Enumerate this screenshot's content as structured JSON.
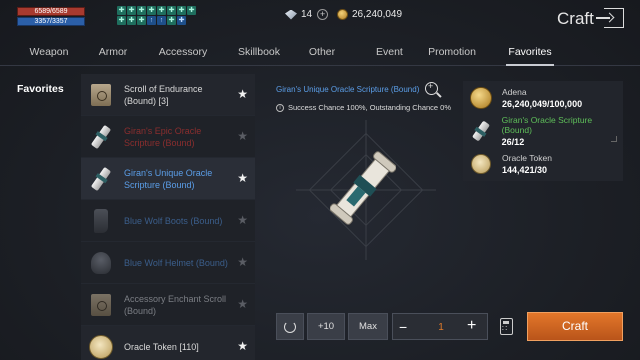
{
  "status": {
    "hp": "6589/6589",
    "mp": "3357/3357",
    "buffs": [
      "✚",
      "✚",
      "✚",
      "✚",
      "✚",
      "✚",
      "✚",
      "✚",
      "✚",
      "✚",
      "✚",
      "↑",
      "↑",
      "✚",
      "✚"
    ],
    "gems": "14",
    "adena": "26,240,049"
  },
  "header": {
    "title": "Craft"
  },
  "tabs": [
    "Weapon",
    "Armor",
    "Accessory",
    "Skillbook",
    "Other",
    "Event",
    "Promotion",
    "Favorites"
  ],
  "sidenav": {
    "label": "Favorites"
  },
  "items": [
    {
      "name": "Scroll of Endurance (Bound) [3]",
      "color": "white",
      "thumb": "scroll",
      "starred": true
    },
    {
      "name": "Giran's Epic Oracle Scripture (Bound)",
      "color": "red",
      "thumb": "oracle",
      "starred": true
    },
    {
      "name": "Giran's Unique Oracle Scripture (Bound)",
      "color": "blue",
      "thumb": "oracle",
      "starred": true
    },
    {
      "name": "Blue Wolf Boots (Bound)",
      "color": "blue-dim",
      "thumb": "boots",
      "starred": true
    },
    {
      "name": "Blue Wolf Helmet (Bound)",
      "color": "blue-dim",
      "thumb": "helmet",
      "starred": true
    },
    {
      "name": "Accessory Enchant Scroll (Bound)",
      "color": "gray",
      "thumb": "scroll",
      "starred": true
    },
    {
      "name": "Oracle Token [110]",
      "color": "white",
      "thumb": "token",
      "starred": true
    }
  ],
  "detail": {
    "title": "Giran's Unique Oracle Scripture (Bound)",
    "info": "Success Chance 100%, Outstanding Chance 0%"
  },
  "materials": [
    {
      "name": "Adena",
      "amount": "26,240,049/100,000",
      "icon": "coin-icon"
    },
    {
      "name": "Giran's Oracle Scripture (Bound)",
      "amount": "26/12",
      "icon": "oracle-scripture-icon"
    },
    {
      "name": "Oracle Token",
      "amount": "144,421/30",
      "icon": "oracle-token-icon"
    }
  ],
  "controls": {
    "plus10": "+10",
    "max": "Max",
    "minus": "−",
    "quantity": "1",
    "plus": "+",
    "craft": "Craft"
  }
}
